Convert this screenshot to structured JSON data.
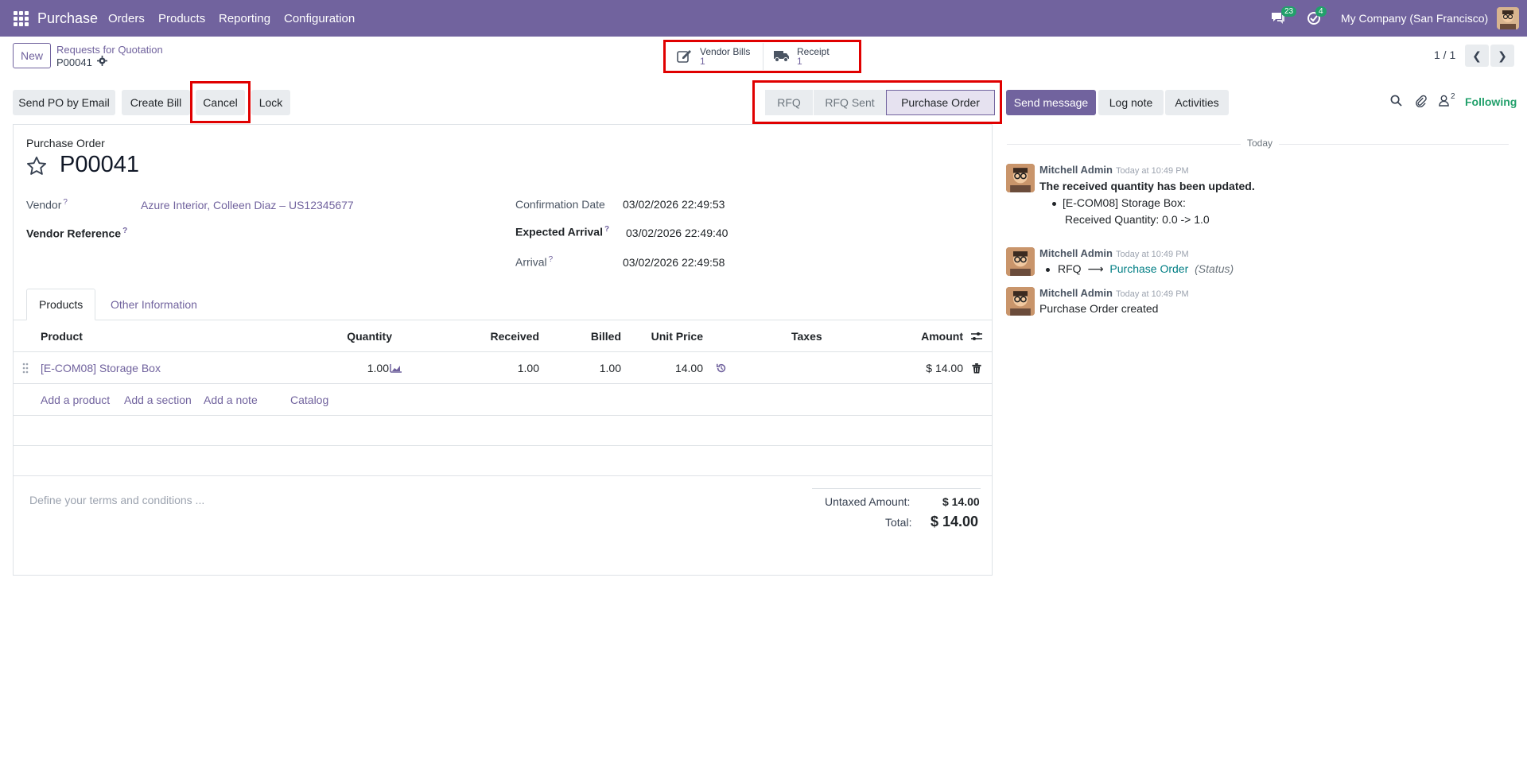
{
  "navbar": {
    "brand": "Purchase",
    "menu": [
      "Orders",
      "Products",
      "Reporting",
      "Configuration"
    ],
    "messages_count": "23",
    "activities_count": "4",
    "company": "My Company (San Francisco)"
  },
  "control_panel": {
    "new_label": "New",
    "breadcrumb": "Requests for Quotation",
    "record": "P00041",
    "smart_buttons": [
      {
        "label": "Vendor Bills",
        "value": "1",
        "icon": "pencil-square-icon"
      },
      {
        "label": "Receipt",
        "value": "1",
        "icon": "truck-icon"
      }
    ],
    "pager": "1 / 1"
  },
  "actions": {
    "send_po": "Send PO by Email",
    "create_bill": "Create Bill",
    "cancel": "Cancel",
    "lock": "Lock"
  },
  "statusbar": {
    "stages": [
      "RFQ",
      "RFQ Sent",
      "Purchase Order"
    ],
    "active": "Purchase Order"
  },
  "chatter_buttons": {
    "send_message": "Send message",
    "log_note": "Log note",
    "activities": "Activities",
    "followers_count": "2",
    "following": "Following"
  },
  "form": {
    "title_label": "Purchase Order",
    "name": "P00041",
    "vendor_label": "Vendor",
    "vendor_value": "Azure Interior, Colleen Diaz – US12345677",
    "vendor_ref_label": "Vendor Reference",
    "confirmation_label": "Confirmation Date",
    "confirmation_value": "03/02/2026 22:49:53",
    "expected_label": "Expected Arrival",
    "expected_value": "03/02/2026 22:49:40",
    "arrival_label": "Arrival",
    "arrival_value": "03/02/2026 22:49:58",
    "help_mark": "?"
  },
  "tabs": [
    "Products",
    "Other Information"
  ],
  "lines": {
    "headers": {
      "product": "Product",
      "quantity": "Quantity",
      "received": "Received",
      "billed": "Billed",
      "unit_price": "Unit Price",
      "taxes": "Taxes",
      "amount": "Amount"
    },
    "rows": [
      {
        "product": "[E-COM08] Storage Box",
        "quantity": "1.00",
        "received": "1.00",
        "billed": "1.00",
        "unit_price": "14.00",
        "taxes": "",
        "amount": "$ 14.00"
      }
    ],
    "add_links": [
      "Add a product",
      "Add a section",
      "Add a note",
      "Catalog"
    ]
  },
  "terms_placeholder": "Define your terms and conditions ...",
  "totals": {
    "untaxed_label": "Untaxed Amount:",
    "untaxed_value": "$ 14.00",
    "total_label": "Total:",
    "total_value": "$ 14.00"
  },
  "chatter": {
    "date_separator": "Today",
    "messages": [
      {
        "author": "Mitchell Admin",
        "time": "Today at 10:49 PM",
        "title": "The received quantity has been updated.",
        "item": "[E-COM08] Storage Box:",
        "detail": "Received Quantity: 0.0 -> 1.0"
      },
      {
        "author": "Mitchell Admin",
        "time": "Today at 10:49 PM",
        "from": "RFQ",
        "arrow": "⟶",
        "to": "Purchase Order",
        "field": "(Status)"
      },
      {
        "author": "Mitchell Admin",
        "time": "Today at 10:49 PM",
        "text": "Purchase Order created"
      }
    ]
  }
}
